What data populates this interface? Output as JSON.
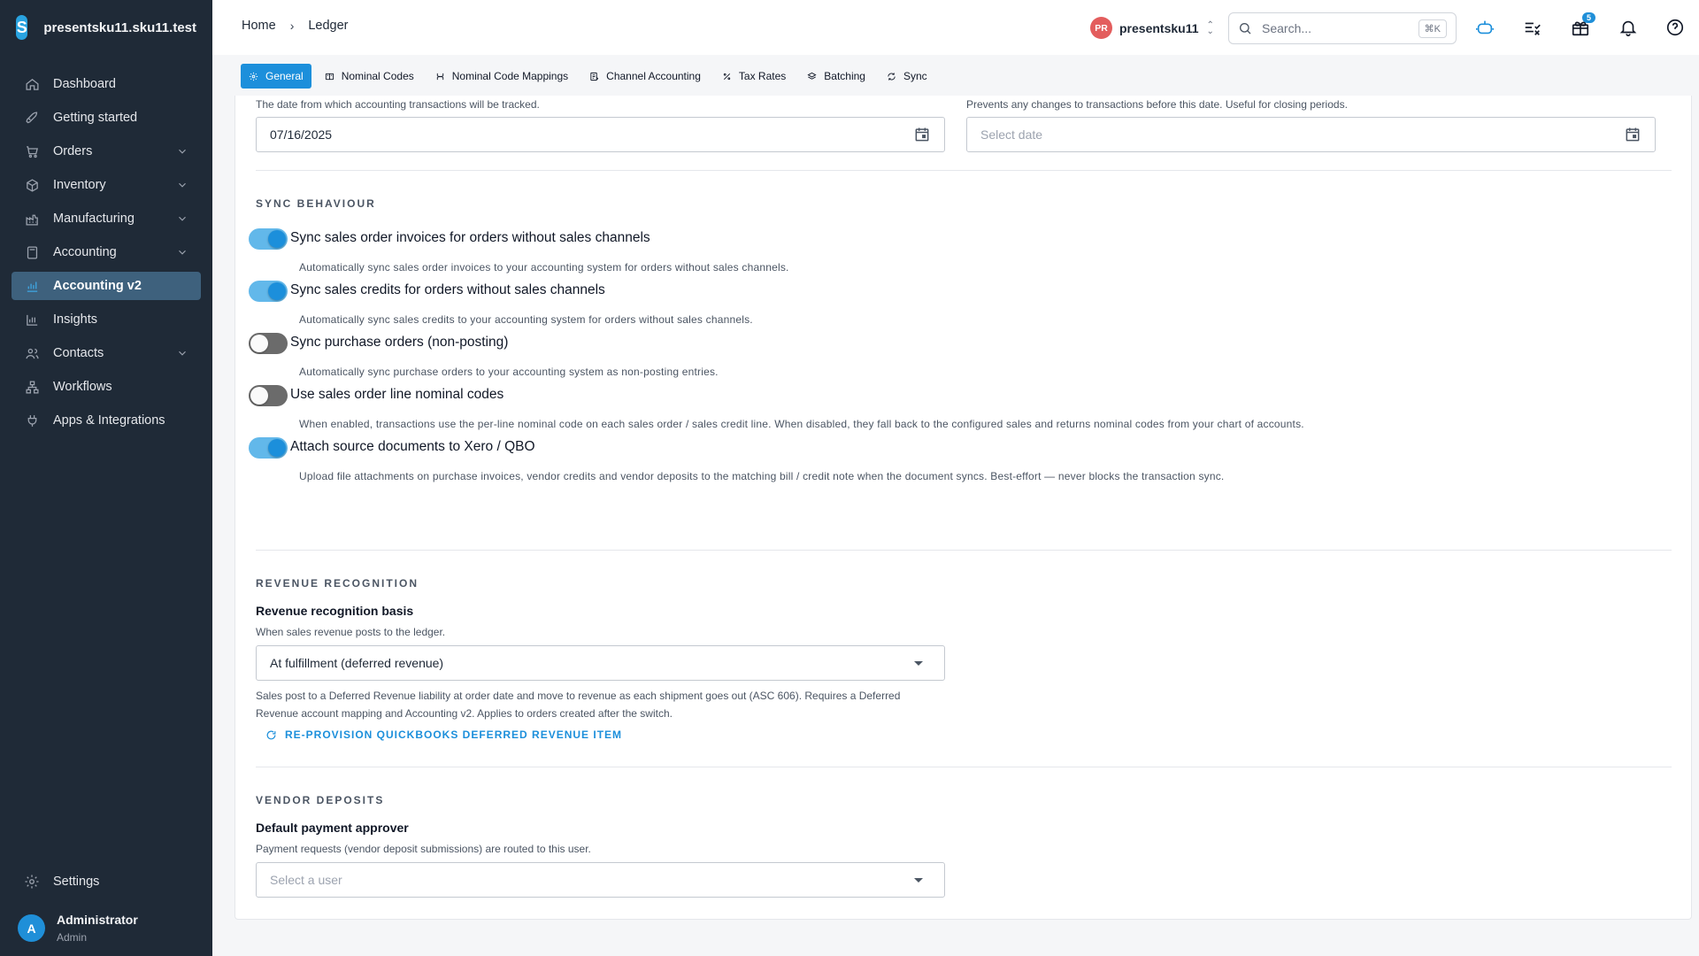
{
  "app": {
    "org_name": "presentsku11.sku11.test",
    "logo_letter": "S"
  },
  "sidebar": {
    "items": [
      {
        "label": "Dashboard",
        "icon": "home-icon",
        "expandable": false,
        "active": false
      },
      {
        "label": "Getting started",
        "icon": "rocket-icon",
        "expandable": false,
        "active": false
      },
      {
        "label": "Orders",
        "icon": "cart-icon",
        "expandable": true,
        "active": false
      },
      {
        "label": "Inventory",
        "icon": "box-icon",
        "expandable": true,
        "active": false
      },
      {
        "label": "Manufacturing",
        "icon": "factory-icon",
        "expandable": true,
        "active": false
      },
      {
        "label": "Accounting",
        "icon": "calculator-icon",
        "expandable": true,
        "active": false
      },
      {
        "label": "Accounting v2",
        "icon": "chart-icon",
        "expandable": false,
        "active": true
      },
      {
        "label": "Insights",
        "icon": "bar-chart-icon",
        "expandable": false,
        "active": false
      },
      {
        "label": "Contacts",
        "icon": "users-icon",
        "expandable": true,
        "active": false
      },
      {
        "label": "Workflows",
        "icon": "workflow-icon",
        "expandable": false,
        "active": false
      },
      {
        "label": "Apps & Integrations",
        "icon": "plug-icon",
        "expandable": false,
        "active": false
      }
    ],
    "settings_label": "Settings",
    "user": {
      "initial": "A",
      "name": "Administrator",
      "role": "Admin"
    }
  },
  "header": {
    "breadcrumb": [
      "Home",
      "Ledger"
    ],
    "account": {
      "initials": "PR",
      "name": "presentsku11"
    },
    "search": {
      "placeholder": "Search...",
      "shortcut": "⌘K"
    },
    "gift_badge": "5"
  },
  "tabs": [
    {
      "label": "General",
      "icon": "gear-icon",
      "active": true
    },
    {
      "label": "Nominal Codes",
      "icon": "book-icon",
      "active": false
    },
    {
      "label": "Nominal Code Mappings",
      "icon": "mapping-icon",
      "active": false
    },
    {
      "label": "Channel Accounting",
      "icon": "ledger-icon",
      "active": false
    },
    {
      "label": "Tax Rates",
      "icon": "percent-icon",
      "active": false
    },
    {
      "label": "Batching",
      "icon": "layers-icon",
      "active": false
    },
    {
      "label": "Sync",
      "icon": "sync-icon",
      "active": false
    }
  ],
  "dates": {
    "start_helper": "The date from which accounting transactions will be tracked.",
    "start_value": "07/16/2025",
    "lock_helper": "Prevents any changes to transactions before this date. Useful for closing periods.",
    "lock_placeholder": "Select date"
  },
  "sync_behaviour": {
    "title": "SYNC BEHAVIOUR",
    "toggles": [
      {
        "label": "Sync sales order invoices for orders without sales channels",
        "description": "Automatically sync sales order invoices to your accounting system for orders without sales channels.",
        "on": true
      },
      {
        "label": "Sync sales credits for orders without sales channels",
        "description": "Automatically sync sales credits to your accounting system for orders without sales channels.",
        "on": true
      },
      {
        "label": "Sync purchase orders (non-posting)",
        "description": "Automatically sync purchase orders to your accounting system as non-posting entries.",
        "on": false
      },
      {
        "label": "Use sales order line nominal codes",
        "description": "When enabled, transactions use the per-line nominal code on each sales order / sales credit line. When disabled, they fall back to the configured sales and returns nominal codes from your chart of accounts.",
        "on": false
      },
      {
        "label": "Attach source documents to Xero / QBO",
        "description": "Upload file attachments on purchase invoices, vendor credits and vendor deposits to the matching bill / credit note when the document syncs. Best-effort — never blocks the transaction sync.",
        "on": true
      }
    ]
  },
  "revenue": {
    "title": "REVENUE RECOGNITION",
    "field_label": "Revenue recognition basis",
    "helper": "When sales revenue posts to the ledger.",
    "selected": "At fulfillment (deferred revenue)",
    "explanation_line1": "Sales post to a Deferred Revenue liability at order date and move to revenue as each shipment goes out (ASC 606). Requires a Deferred",
    "explanation_line2": "Revenue account mapping and Accounting v2. Applies to orders created after the switch.",
    "action": "RE-PROVISION QUICKBOOKS DEFERRED REVENUE ITEM"
  },
  "vendor_deposits": {
    "title": "VENDOR DEPOSITS",
    "field_label": "Default payment approver",
    "helper": "Payment requests (vendor deposit submissions) are routed to this user.",
    "placeholder": "Select a user"
  }
}
